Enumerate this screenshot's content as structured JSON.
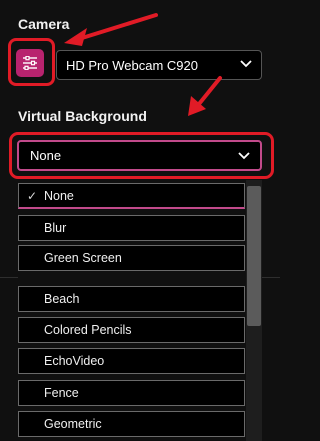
{
  "camera": {
    "title": "Camera",
    "selected_device": "HD Pro Webcam C920",
    "settings_icon": "sliders-icon"
  },
  "virtual_background": {
    "title": "Virtual Background",
    "selected": "None",
    "options": [
      "None",
      "Blur",
      "Green Screen",
      "Beach",
      "Colored Pencils",
      "EchoVideo",
      "Fence",
      "Geometric"
    ]
  },
  "colors": {
    "accent": "#b8236e",
    "annotation": "#e11b26",
    "background": "#101010"
  }
}
